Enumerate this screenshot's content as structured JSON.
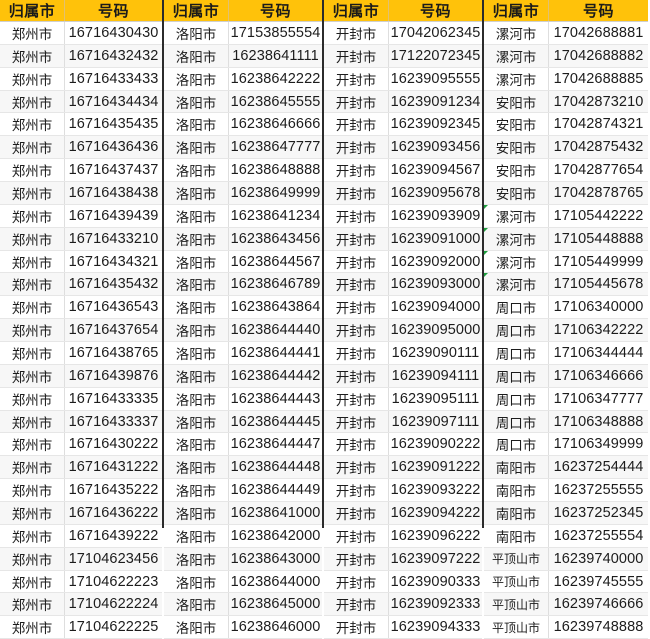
{
  "document": {
    "type": "spreadsheet-table",
    "header_background": "#FFC20A",
    "header_text_color": "#1A1A1A",
    "flag_color": "#1E9E3E",
    "columns": {
      "city_header": "归属市",
      "number_header": "号码"
    }
  },
  "blocks": [
    {
      "id": "block-1",
      "header": {
        "city": "归属市",
        "number": "号码"
      },
      "rows": [
        {
          "city": "郑州市",
          "number": "16716430430",
          "flag": false
        },
        {
          "city": "郑州市",
          "number": "16716432432",
          "flag": false
        },
        {
          "city": "郑州市",
          "number": "16716433433",
          "flag": false
        },
        {
          "city": "郑州市",
          "number": "16716434434",
          "flag": false
        },
        {
          "city": "郑州市",
          "number": "16716435435",
          "flag": false
        },
        {
          "city": "郑州市",
          "number": "16716436436",
          "flag": false
        },
        {
          "city": "郑州市",
          "number": "16716437437",
          "flag": false
        },
        {
          "city": "郑州市",
          "number": "16716438438",
          "flag": false
        },
        {
          "city": "郑州市",
          "number": "16716439439",
          "flag": false
        },
        {
          "city": "郑州市",
          "number": "16716433210",
          "flag": false
        },
        {
          "city": "郑州市",
          "number": "16716434321",
          "flag": false
        },
        {
          "city": "郑州市",
          "number": "16716435432",
          "flag": false
        },
        {
          "city": "郑州市",
          "number": "16716436543",
          "flag": false
        },
        {
          "city": "郑州市",
          "number": "16716437654",
          "flag": false
        },
        {
          "city": "郑州市",
          "number": "16716438765",
          "flag": false
        },
        {
          "city": "郑州市",
          "number": "16716439876",
          "flag": false
        },
        {
          "city": "郑州市",
          "number": "16716433335",
          "flag": false
        },
        {
          "city": "郑州市",
          "number": "16716433337",
          "flag": false
        },
        {
          "city": "郑州市",
          "number": "16716430222",
          "flag": false
        },
        {
          "city": "郑州市",
          "number": "16716431222",
          "flag": false
        },
        {
          "city": "郑州市",
          "number": "16716435222",
          "flag": false
        },
        {
          "city": "郑州市",
          "number": "16716436222",
          "flag": false
        },
        {
          "city": "郑州市",
          "number": "16716439222",
          "flag": false
        },
        {
          "city": "郑州市",
          "number": "17104623456",
          "flag": false
        },
        {
          "city": "郑州市",
          "number": "17104622223",
          "flag": false
        },
        {
          "city": "郑州市",
          "number": "17104622224",
          "flag": false
        },
        {
          "city": "郑州市",
          "number": "17104622225",
          "flag": false
        }
      ]
    },
    {
      "id": "block-2",
      "header": {
        "city": "归属市",
        "number": "号码"
      },
      "rows": [
        {
          "city": "洛阳市",
          "number": "17153855554",
          "flag": false
        },
        {
          "city": "洛阳市",
          "number": "16238641111",
          "flag": false
        },
        {
          "city": "洛阳市",
          "number": "16238642222",
          "flag": false
        },
        {
          "city": "洛阳市",
          "number": "16238645555",
          "flag": false
        },
        {
          "city": "洛阳市",
          "number": "16238646666",
          "flag": false
        },
        {
          "city": "洛阳市",
          "number": "16238647777",
          "flag": false
        },
        {
          "city": "洛阳市",
          "number": "16238648888",
          "flag": false
        },
        {
          "city": "洛阳市",
          "number": "16238649999",
          "flag": false
        },
        {
          "city": "洛阳市",
          "number": "16238641234",
          "flag": false
        },
        {
          "city": "洛阳市",
          "number": "16238643456",
          "flag": false
        },
        {
          "city": "洛阳市",
          "number": "16238644567",
          "flag": false
        },
        {
          "city": "洛阳市",
          "number": "16238646789",
          "flag": false
        },
        {
          "city": "洛阳市",
          "number": "16238643864",
          "flag": false
        },
        {
          "city": "洛阳市",
          "number": "16238644440",
          "flag": false
        },
        {
          "city": "洛阳市",
          "number": "16238644441",
          "flag": false
        },
        {
          "city": "洛阳市",
          "number": "16238644442",
          "flag": false
        },
        {
          "city": "洛阳市",
          "number": "16238644443",
          "flag": false
        },
        {
          "city": "洛阳市",
          "number": "16238644445",
          "flag": false
        },
        {
          "city": "洛阳市",
          "number": "16238644447",
          "flag": false
        },
        {
          "city": "洛阳市",
          "number": "16238644448",
          "flag": false
        },
        {
          "city": "洛阳市",
          "number": "16238644449",
          "flag": false
        },
        {
          "city": "洛阳市",
          "number": "16238641000",
          "flag": false
        },
        {
          "city": "洛阳市",
          "number": "16238642000",
          "flag": false
        },
        {
          "city": "洛阳市",
          "number": "16238643000",
          "flag": false
        },
        {
          "city": "洛阳市",
          "number": "16238644000",
          "flag": false
        },
        {
          "city": "洛阳市",
          "number": "16238645000",
          "flag": false
        },
        {
          "city": "洛阳市",
          "number": "16238646000",
          "flag": false
        }
      ]
    },
    {
      "id": "block-3",
      "header": {
        "city": "归属市",
        "number": "号码"
      },
      "rows": [
        {
          "city": "开封市",
          "number": "17042062345",
          "flag": false
        },
        {
          "city": "开封市",
          "number": "17122072345",
          "flag": false
        },
        {
          "city": "开封市",
          "number": "16239095555",
          "flag": false
        },
        {
          "city": "开封市",
          "number": "16239091234",
          "flag": false
        },
        {
          "city": "开封市",
          "number": "16239092345",
          "flag": false
        },
        {
          "city": "开封市",
          "number": "16239093456",
          "flag": false
        },
        {
          "city": "开封市",
          "number": "16239094567",
          "flag": false
        },
        {
          "city": "开封市",
          "number": "16239095678",
          "flag": false
        },
        {
          "city": "开封市",
          "number": "16239093909",
          "flag": false
        },
        {
          "city": "开封市",
          "number": "16239091000",
          "flag": false
        },
        {
          "city": "开封市",
          "number": "16239092000",
          "flag": false
        },
        {
          "city": "开封市",
          "number": "16239093000",
          "flag": false
        },
        {
          "city": "开封市",
          "number": "16239094000",
          "flag": false
        },
        {
          "city": "开封市",
          "number": "16239095000",
          "flag": false
        },
        {
          "city": "开封市",
          "number": "16239090111",
          "flag": false
        },
        {
          "city": "开封市",
          "number": "16239094111",
          "flag": false
        },
        {
          "city": "开封市",
          "number": "16239095111",
          "flag": false
        },
        {
          "city": "开封市",
          "number": "16239097111",
          "flag": false
        },
        {
          "city": "开封市",
          "number": "16239090222",
          "flag": false
        },
        {
          "city": "开封市",
          "number": "16239091222",
          "flag": false
        },
        {
          "city": "开封市",
          "number": "16239093222",
          "flag": false
        },
        {
          "city": "开封市",
          "number": "16239094222",
          "flag": false
        },
        {
          "city": "开封市",
          "number": "16239096222",
          "flag": false
        },
        {
          "city": "开封市",
          "number": "16239097222",
          "flag": false
        },
        {
          "city": "开封市",
          "number": "16239090333",
          "flag": false
        },
        {
          "city": "开封市",
          "number": "16239092333",
          "flag": false
        },
        {
          "city": "开封市",
          "number": "16239094333",
          "flag": false
        }
      ]
    },
    {
      "id": "block-4",
      "header": {
        "city": "归属市",
        "number": "号码"
      },
      "rows": [
        {
          "city": "漯河市",
          "number": "17042688881",
          "flag": false
        },
        {
          "city": "漯河市",
          "number": "17042688882",
          "flag": false
        },
        {
          "city": "漯河市",
          "number": "17042688885",
          "flag": false
        },
        {
          "city": "安阳市",
          "number": "17042873210",
          "flag": false
        },
        {
          "city": "安阳市",
          "number": "17042874321",
          "flag": false
        },
        {
          "city": "安阳市",
          "number": "17042875432",
          "flag": false
        },
        {
          "city": "安阳市",
          "number": "17042877654",
          "flag": false
        },
        {
          "city": "安阳市",
          "number": "17042878765",
          "flag": false
        },
        {
          "city": "漯河市",
          "number": "17105442222",
          "flag": true
        },
        {
          "city": "漯河市",
          "number": "17105448888",
          "flag": true
        },
        {
          "city": "漯河市",
          "number": "17105449999",
          "flag": true
        },
        {
          "city": "漯河市",
          "number": "17105445678",
          "flag": true
        },
        {
          "city": "周口市",
          "number": "17106340000",
          "flag": false
        },
        {
          "city": "周口市",
          "number": "17106342222",
          "flag": false
        },
        {
          "city": "周口市",
          "number": "17106344444",
          "flag": false
        },
        {
          "city": "周口市",
          "number": "17106346666",
          "flag": false
        },
        {
          "city": "周口市",
          "number": "17106347777",
          "flag": false
        },
        {
          "city": "周口市",
          "number": "17106348888",
          "flag": false
        },
        {
          "city": "周口市",
          "number": "17106349999",
          "flag": false
        },
        {
          "city": "南阳市",
          "number": "16237254444",
          "flag": false
        },
        {
          "city": "南阳市",
          "number": "16237255555",
          "flag": false
        },
        {
          "city": "南阳市",
          "number": "16237252345",
          "flag": false
        },
        {
          "city": "南阳市",
          "number": "16237255554",
          "flag": false
        },
        {
          "city": "平顶山市",
          "number": "16239740000",
          "flag": false
        },
        {
          "city": "平顶山市",
          "number": "16239745555",
          "flag": false
        },
        {
          "city": "平顶山市",
          "number": "16239746666",
          "flag": false
        },
        {
          "city": "平顶山市",
          "number": "16239748888",
          "flag": false
        }
      ]
    }
  ]
}
